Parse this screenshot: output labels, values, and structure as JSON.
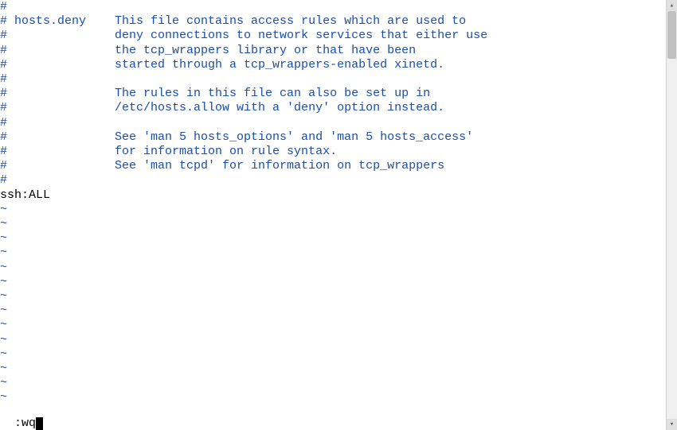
{
  "editor": {
    "lines": [
      {
        "type": "comment",
        "text": "#"
      },
      {
        "type": "comment",
        "text": "# hosts.deny    This file contains access rules which are used to"
      },
      {
        "type": "comment",
        "text": "#               deny connections to network services that either use"
      },
      {
        "type": "comment",
        "text": "#               the tcp_wrappers library or that have been"
      },
      {
        "type": "comment",
        "text": "#               started through a tcp_wrappers-enabled xinetd."
      },
      {
        "type": "comment",
        "text": "#"
      },
      {
        "type": "comment",
        "text": "#               The rules in this file can also be set up in"
      },
      {
        "type": "comment",
        "text": "#               /etc/hosts.allow with a 'deny' option instead."
      },
      {
        "type": "comment",
        "text": "#"
      },
      {
        "type": "comment",
        "text": "#               See 'man 5 hosts_options' and 'man 5 hosts_access'"
      },
      {
        "type": "comment",
        "text": "#               for information on rule syntax."
      },
      {
        "type": "comment",
        "text": "#               See 'man tcpd' for information on tcp_wrappers"
      },
      {
        "type": "comment",
        "text": "#"
      },
      {
        "type": "text",
        "text": "ssh:ALL"
      }
    ],
    "tilde": "~",
    "tilde_count": 14
  },
  "status": {
    "command": ":wq"
  },
  "scrollbar": {
    "up": "▴",
    "down": "▾"
  }
}
